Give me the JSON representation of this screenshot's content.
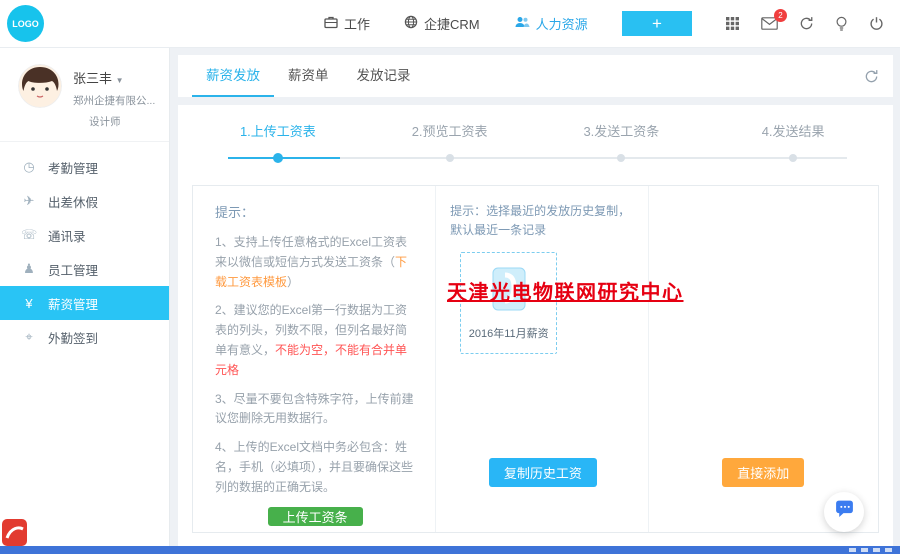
{
  "topbar": {
    "logo_text": "LOGO",
    "nav": [
      {
        "label": "工作",
        "icon": "briefcase-icon"
      },
      {
        "label": "企捷CRM",
        "icon": "globe-icon"
      },
      {
        "label": "人力资源",
        "icon": "people-icon",
        "active": true
      }
    ],
    "add_button_label": "+",
    "mail_badge": "2",
    "icons": [
      "apps-grid-icon",
      "mail-icon",
      "refresh-icon",
      "bulb-icon",
      "power-icon"
    ]
  },
  "sidebar": {
    "user": {
      "name": "张三丰",
      "company": "郑州企捷有限公...",
      "title": "设计师"
    },
    "menu": [
      {
        "label": "考勤管理",
        "icon": "attendance-clock-icon",
        "char": "◷"
      },
      {
        "label": "出差休假",
        "icon": "travel-leave-icon",
        "char": "✈"
      },
      {
        "label": "通讯录",
        "icon": "contacts-icon",
        "char": "☏"
      },
      {
        "label": "员工管理",
        "icon": "employees-icon",
        "char": "♟"
      },
      {
        "label": "薪资管理",
        "icon": "salary-icon",
        "char": "¥",
        "active": true
      },
      {
        "label": "外勤签到",
        "icon": "field-checkin-icon",
        "char": "⌖"
      }
    ]
  },
  "tabs": {
    "items": [
      {
        "label": "薪资发放",
        "active": true
      },
      {
        "label": "薪资单"
      },
      {
        "label": "发放记录"
      }
    ]
  },
  "stepper": {
    "steps": [
      {
        "label": "1.上传工资表",
        "active": true
      },
      {
        "label": "2.预览工资表"
      },
      {
        "label": "3.发送工资条"
      },
      {
        "label": "4.发送结果"
      }
    ]
  },
  "upload_panel": {
    "tips_title": "提示：",
    "tip1_pre": "1、支持上传任意格式的Excel工资表来以微信或短信方式发送工资条（",
    "tip1_link": "下载工资表模板",
    "tip1_post": "）",
    "tip2_pre": "2、建议您的Excel第一行数据为工资表的列头，列数不限，但列名最好简单有意义，",
    "tip2_red": "不能为空，不能有合并单元格",
    "tip3": "3、尽量不要包含特殊字符，上传前建议您删除无用数据行。",
    "tip4": "4、上传的Excel文档中务必包含：姓名，手机（必填项），并且要确保这些列的数据的正确无误。",
    "upload_button_label": "上传工资条"
  },
  "history_panel": {
    "tip": "提示：选择最近的发放历史复制，默认最近一条记录",
    "card_label": "2016年11月薪资",
    "copy_button_label": "复制历史工资"
  },
  "direct_panel": {
    "add_button_label": "直接添加"
  },
  "watermark_text": "天津光电物联网研究中心",
  "colors": {
    "accent_blue": "#29b6f6",
    "sidebar_active_cyan": "#29c4f5",
    "green_button": "#47b04b",
    "orange_button": "#ffa83c",
    "link_orange": "#ff9a40",
    "warning_red": "#ff5454",
    "watermark_red": "#e60012",
    "badge_red": "#f03e3e"
  }
}
